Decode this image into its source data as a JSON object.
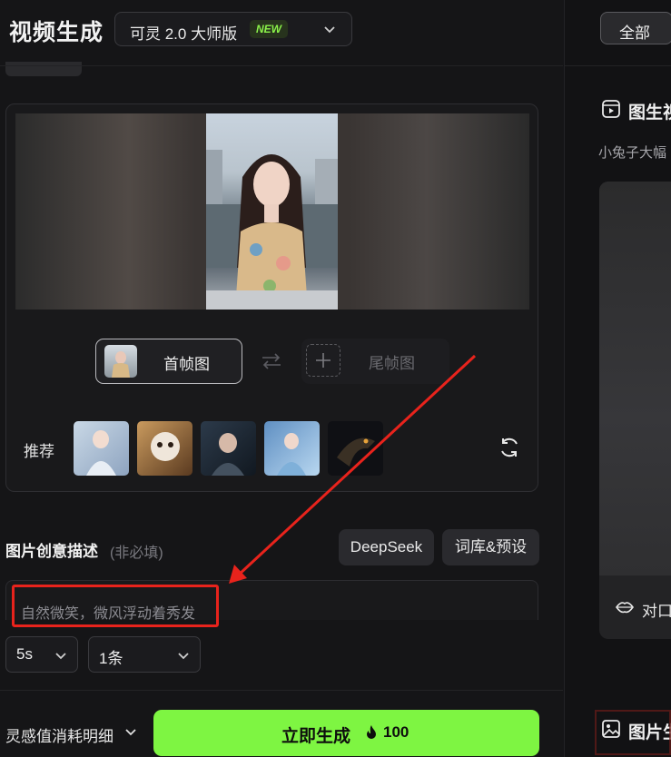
{
  "header": {
    "title": "视频生成",
    "model_label": "可灵 2.0 大师版",
    "model_badge": "NEW"
  },
  "frames": {
    "first_label": "首帧图",
    "last_label": "尾帧图"
  },
  "recommend": {
    "label": "推荐"
  },
  "description": {
    "title": "图片创意描述",
    "optional": "(非必填)",
    "deepseek_label": "DeepSeek",
    "library_label": "词库&预设",
    "text": "自然微笑，微风浮动着秀发"
  },
  "options": {
    "duration": "5s",
    "count": "1条"
  },
  "footer": {
    "cost_label": "灵感值消耗明细",
    "generate_label": "立即生成",
    "generate_cost": "100"
  },
  "right": {
    "tab_all": "全部",
    "heading1": "图生视",
    "subtitle": "小兔子大幅",
    "lip_label": "对口",
    "heading2": "图片生"
  },
  "colors": {
    "accent": "#7ef542",
    "annotation": "#e8231c",
    "badge_text": "#8bf34a"
  }
}
